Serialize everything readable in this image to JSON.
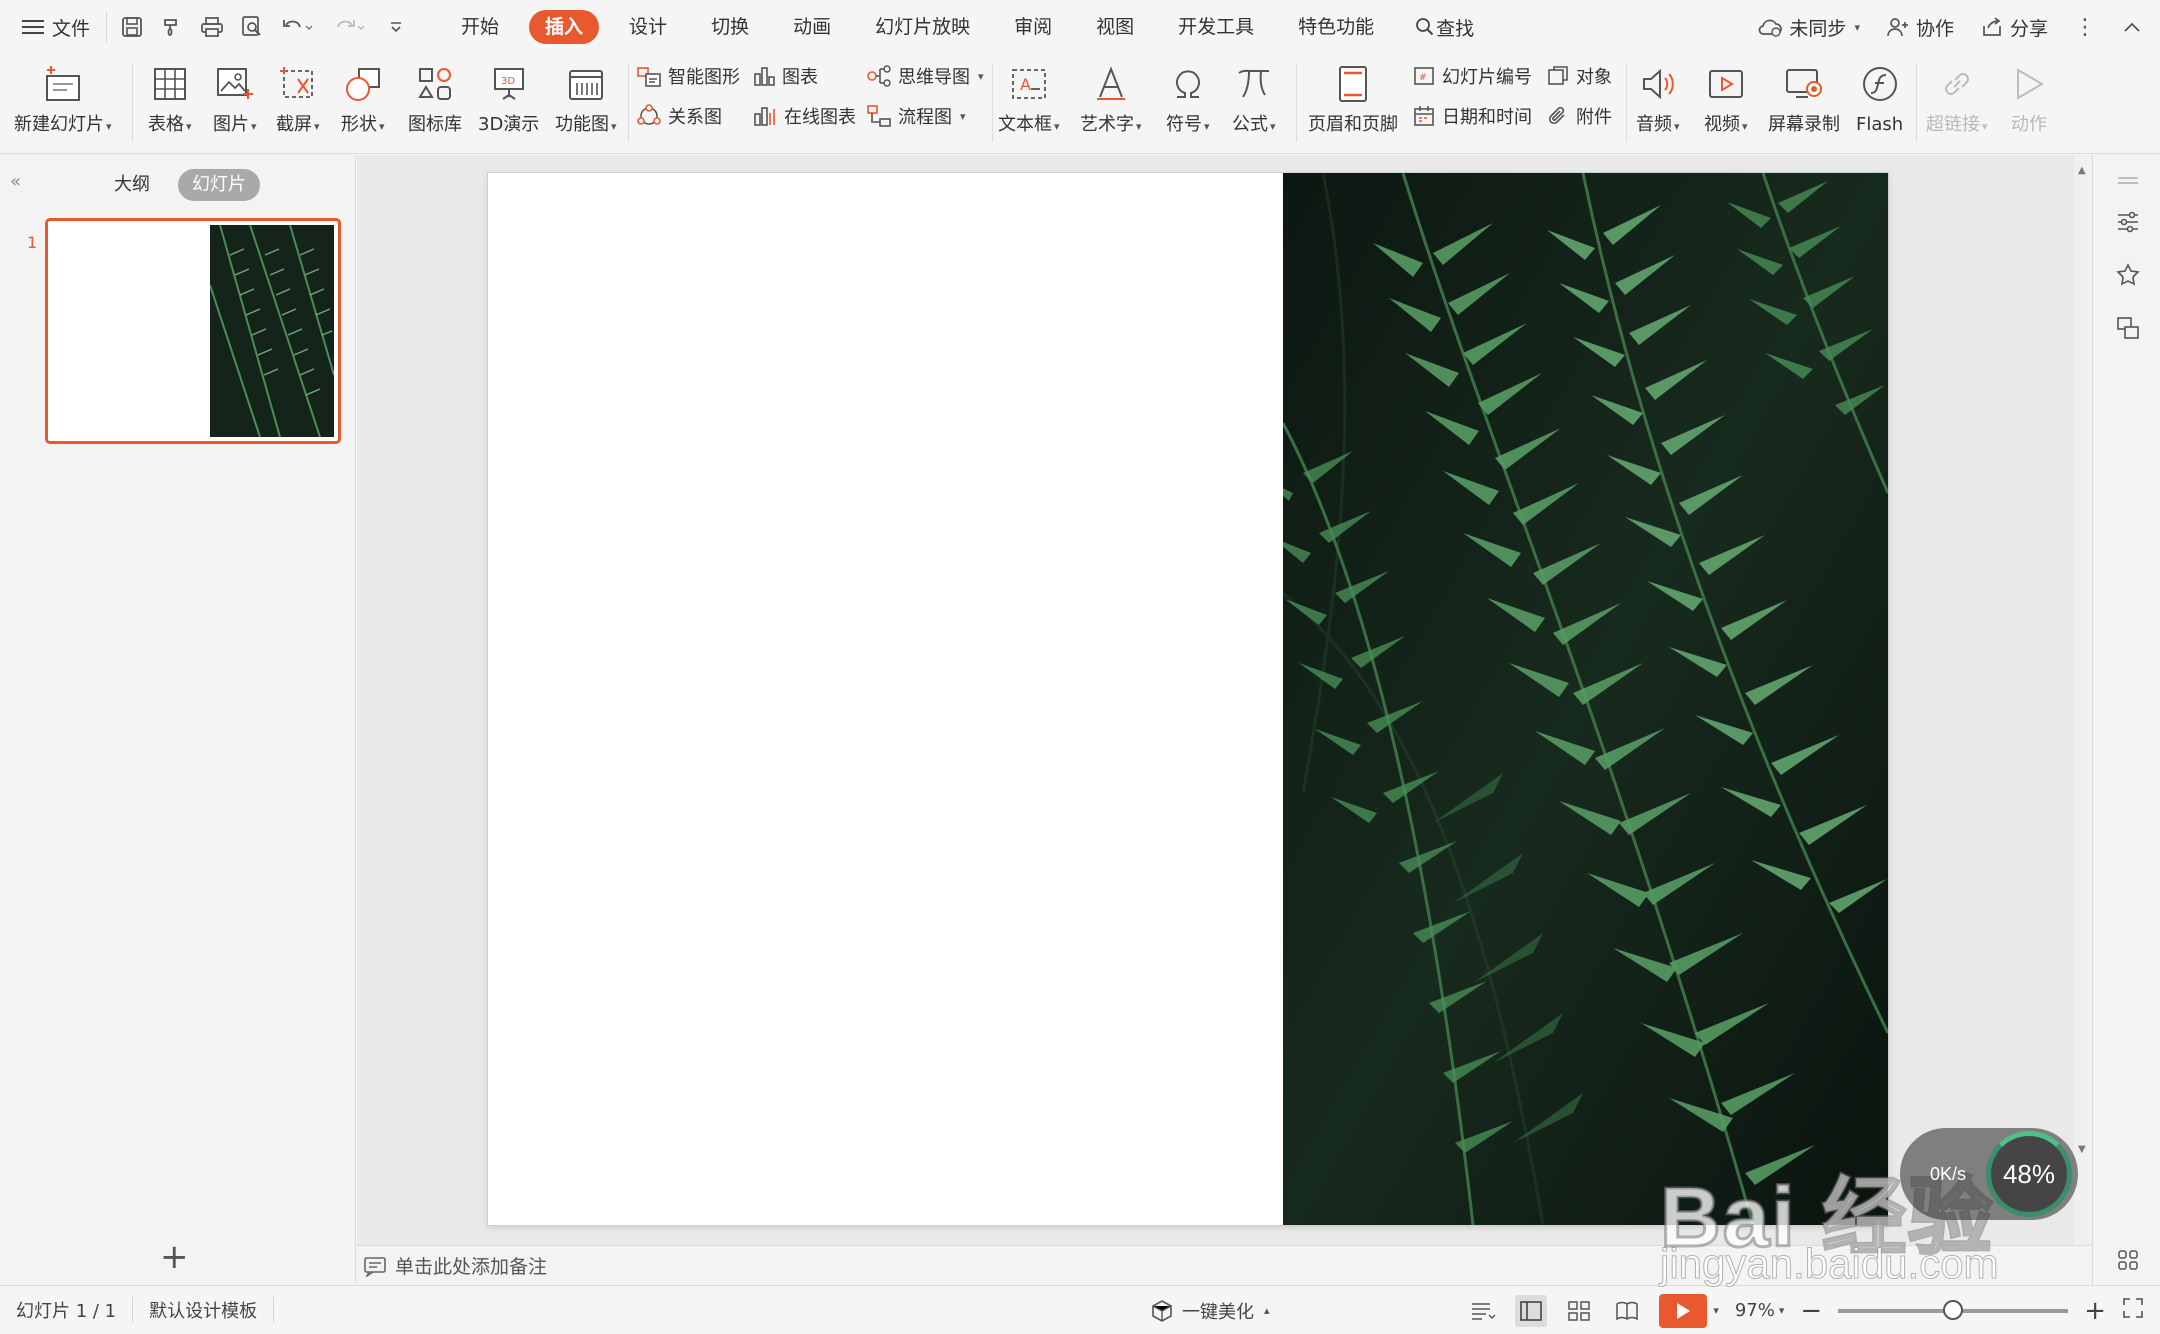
{
  "menubar": {
    "file_label": "文件",
    "tabs": [
      "开始",
      "插入",
      "设计",
      "切换",
      "动画",
      "幻灯片放映",
      "审阅",
      "视图",
      "开发工具",
      "特色功能"
    ],
    "active_tab": "插入",
    "find_label": "查找",
    "sync_label": "未同步",
    "collab_label": "协作",
    "share_label": "分享"
  },
  "ribbon": {
    "new_slide": "新建幻灯片",
    "table": "表格",
    "picture": "图片",
    "screenshot": "截屏",
    "shape": "形状",
    "icon_lib": "图标库",
    "demo3d": "3D演示",
    "func_chart": "功能图",
    "smart_art": "智能图形",
    "chart": "图表",
    "mind_map": "思维导图",
    "relation": "关系图",
    "online_chart": "在线图表",
    "flowchart": "流程图",
    "textbox": "文本框",
    "wordart": "艺术字",
    "symbol": "符号",
    "formula": "公式",
    "header_footer": "页眉和页脚",
    "slide_number": "幻灯片编号",
    "object": "对象",
    "date_time": "日期和时间",
    "attachment": "附件",
    "audio": "音频",
    "video": "视频",
    "screen_record": "屏幕录制",
    "flash": "Flash",
    "hyperlink": "超链接",
    "action": "动作"
  },
  "leftpanel": {
    "tab_outline": "大纲",
    "tab_slides": "幻灯片",
    "active_tab": "幻灯片",
    "slide_number": "1",
    "add_symbol": "+"
  },
  "notes": {
    "placeholder": "单击此处添加备注"
  },
  "status": {
    "slide_info": "幻灯片 1 / 1",
    "template": "默认设计模板",
    "beautify": "一键美化",
    "zoom": "97%",
    "zoom_fraction": 0.5
  },
  "watermark": {
    "brand": "Bai 经验",
    "url": "jingyan.baidu.com",
    "speed": "0K/s",
    "percent": "48%"
  },
  "colors": {
    "accent": "#e8592f",
    "panel": "#f3f3f3",
    "fern_dark": "#13231a",
    "fern_green": "#3f8a4c"
  }
}
